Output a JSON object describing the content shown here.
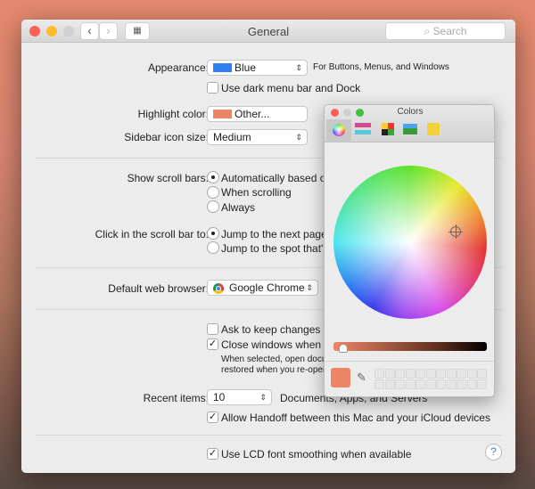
{
  "window": {
    "title": "General",
    "search_placeholder": "Search",
    "nav_back": "‹",
    "nav_forward": "›",
    "grid_icon": "grid-icon"
  },
  "appearance": {
    "label": "Appearance:",
    "value": "Blue",
    "swatch": "#2f7ff2",
    "hint": "For Buttons, Menus, and Windows"
  },
  "dark_menu": {
    "label": "Use dark menu bar and Dock",
    "checked": false
  },
  "highlight": {
    "label": "Highlight color:",
    "value": "Other...",
    "swatch": "#ec8565"
  },
  "sidebar_icon": {
    "label": "Sidebar icon size:",
    "value": "Medium"
  },
  "scroll_bars": {
    "label": "Show scroll bars:",
    "options": [
      "Automatically based o",
      "When scrolling",
      "Always"
    ],
    "selected": 0
  },
  "click_scroll": {
    "label": "Click in the scroll bar to:",
    "options": [
      "Jump to the next page",
      "Jump to the spot that's"
    ],
    "selected": 0
  },
  "browser": {
    "label": "Default web browser:",
    "value": "Google Chrome"
  },
  "ask_keep": {
    "label": "Ask to keep changes w",
    "checked": false
  },
  "close_windows": {
    "label": "Close windows when q",
    "checked": true,
    "desc1": "When selected, open docu",
    "desc2": "restored when you re-oper"
  },
  "recent": {
    "label": "Recent items:",
    "value": "10",
    "suffix": "Documents, Apps, and Servers"
  },
  "handoff": {
    "label": "Allow Handoff between this Mac and your iCloud devices",
    "checked": true
  },
  "lcd": {
    "label": "Use LCD font smoothing when available",
    "checked": true
  },
  "help": "?",
  "colors_panel": {
    "title": "Colors",
    "tabs": [
      "color-wheel",
      "color-sliders",
      "color-palettes",
      "image-palettes",
      "crayons"
    ],
    "selected_tab": 0,
    "current_color": "#ec8565",
    "brightness_percent": 7
  },
  "check": "✓"
}
